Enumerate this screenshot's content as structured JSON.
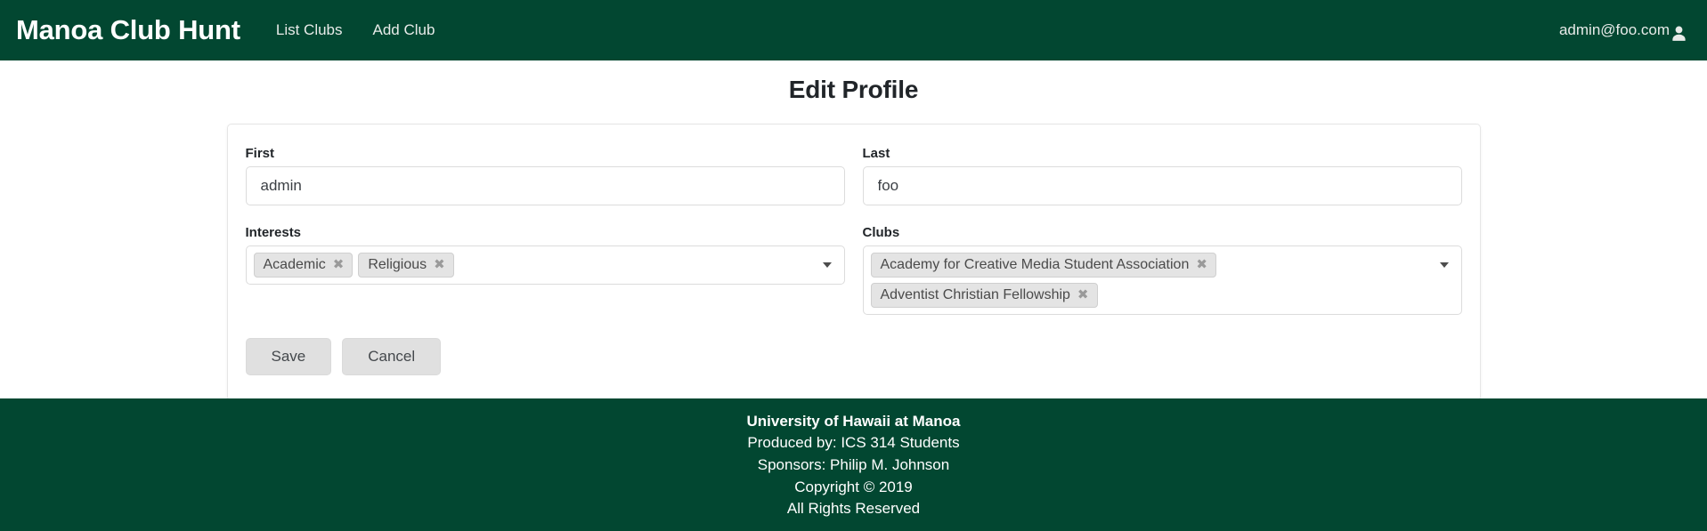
{
  "theme": {
    "brand_green": "#024731",
    "tag_bg": "#e4e4e4",
    "button_bg": "#e0e0e0",
    "card_border": "#e6e6e6"
  },
  "navbar": {
    "brand": "Manoa Club Hunt",
    "links": [
      {
        "label": "List Clubs"
      },
      {
        "label": "Add Club"
      }
    ],
    "user_email": "admin@foo.com",
    "user_icon": "person-icon"
  },
  "main": {
    "page_title": "Edit Profile",
    "fields": {
      "first": {
        "label": "First",
        "value": "admin",
        "placeholder": ""
      },
      "last": {
        "label": "Last",
        "value": "foo",
        "placeholder": ""
      },
      "interests": {
        "label": "Interests",
        "tags": [
          {
            "label": "Academic",
            "remove": "✖"
          },
          {
            "label": "Religious",
            "remove": "✖"
          }
        ],
        "caret_icon": "chevron-down-icon"
      },
      "clubs": {
        "label": "Clubs",
        "tags": [
          {
            "label": "Academy for Creative Media Student Association",
            "remove": "✖"
          },
          {
            "label": "Adventist Christian Fellowship",
            "remove": "✖"
          }
        ],
        "caret_icon": "chevron-down-icon"
      }
    },
    "buttons": {
      "save": "Save",
      "cancel": "Cancel"
    }
  },
  "footer": {
    "lines": [
      "University of Hawaii at Manoa",
      "Produced by: ICS 314 Students",
      "Sponsors: Philip M. Johnson",
      "Copyright © 2019",
      "All Rights Reserved"
    ]
  }
}
